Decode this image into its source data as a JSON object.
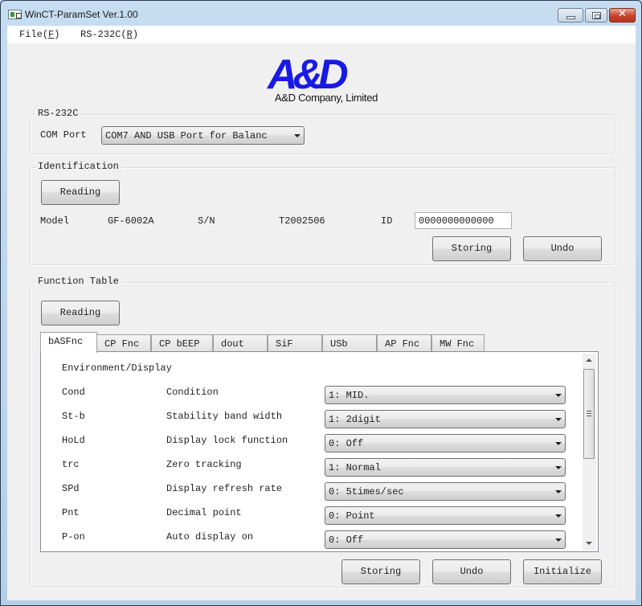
{
  "window": {
    "title": "WinCT-ParamSet Ver.1.00",
    "controls": {
      "minimize": "minimize",
      "maximize": "maximize",
      "close": "✕"
    }
  },
  "menu": [
    {
      "label": "File",
      "mnemonic": "F"
    },
    {
      "label": "RS-232C",
      "mnemonic": "R"
    }
  ],
  "logo": {
    "mark": "A&D",
    "company": "A&D Company, Limited",
    "brand_color": "#1a1ae6"
  },
  "rs232c": {
    "group_label": "RS-232C",
    "com_port_label": "COM Port",
    "com_port_value": "COM7  AND USB Port for Balanc"
  },
  "identification": {
    "group_label": "Identification",
    "reading_button": "Reading",
    "model_label": "Model",
    "model_value": "GF-6002A",
    "sn_label": "S/N",
    "sn_value": "T2002506",
    "id_label": "ID",
    "id_value": "0000000000000",
    "storing_button": "Storing",
    "undo_button": "Undo"
  },
  "function_table": {
    "group_label": "Function Table",
    "reading_button": "Reading",
    "tabs": [
      {
        "label": "bASFnc",
        "active": true
      },
      {
        "label": "CP Fnc",
        "active": false
      },
      {
        "label": "CP bEEP",
        "active": false
      },
      {
        "label": "dout",
        "active": false
      },
      {
        "label": "SiF",
        "active": false
      },
      {
        "label": "USb",
        "active": false
      },
      {
        "label": "AP Fnc",
        "active": false
      },
      {
        "label": "MW Fnc",
        "active": false
      }
    ],
    "section_title": "Environment/Display",
    "rows": [
      {
        "code": "Cond",
        "description": "Condition",
        "value": "1: MID."
      },
      {
        "code": "St-b",
        "description": "Stability band width",
        "value": "1: 2digit"
      },
      {
        "code": "HoLd",
        "description": "Display lock function",
        "value": "0: Off"
      },
      {
        "code": "trc",
        "description": "Zero tracking",
        "value": "1: Normal"
      },
      {
        "code": "SPd",
        "description": "Display refresh rate",
        "value": "0: 5times/sec"
      },
      {
        "code": "Pnt",
        "description": "Decimal point",
        "value": "0: Point"
      },
      {
        "code": "P-on",
        "description": "Auto display on",
        "value": "0: Off"
      }
    ],
    "storing_button": "Storing",
    "undo_button": "Undo",
    "initialize_button": "Initialize"
  }
}
